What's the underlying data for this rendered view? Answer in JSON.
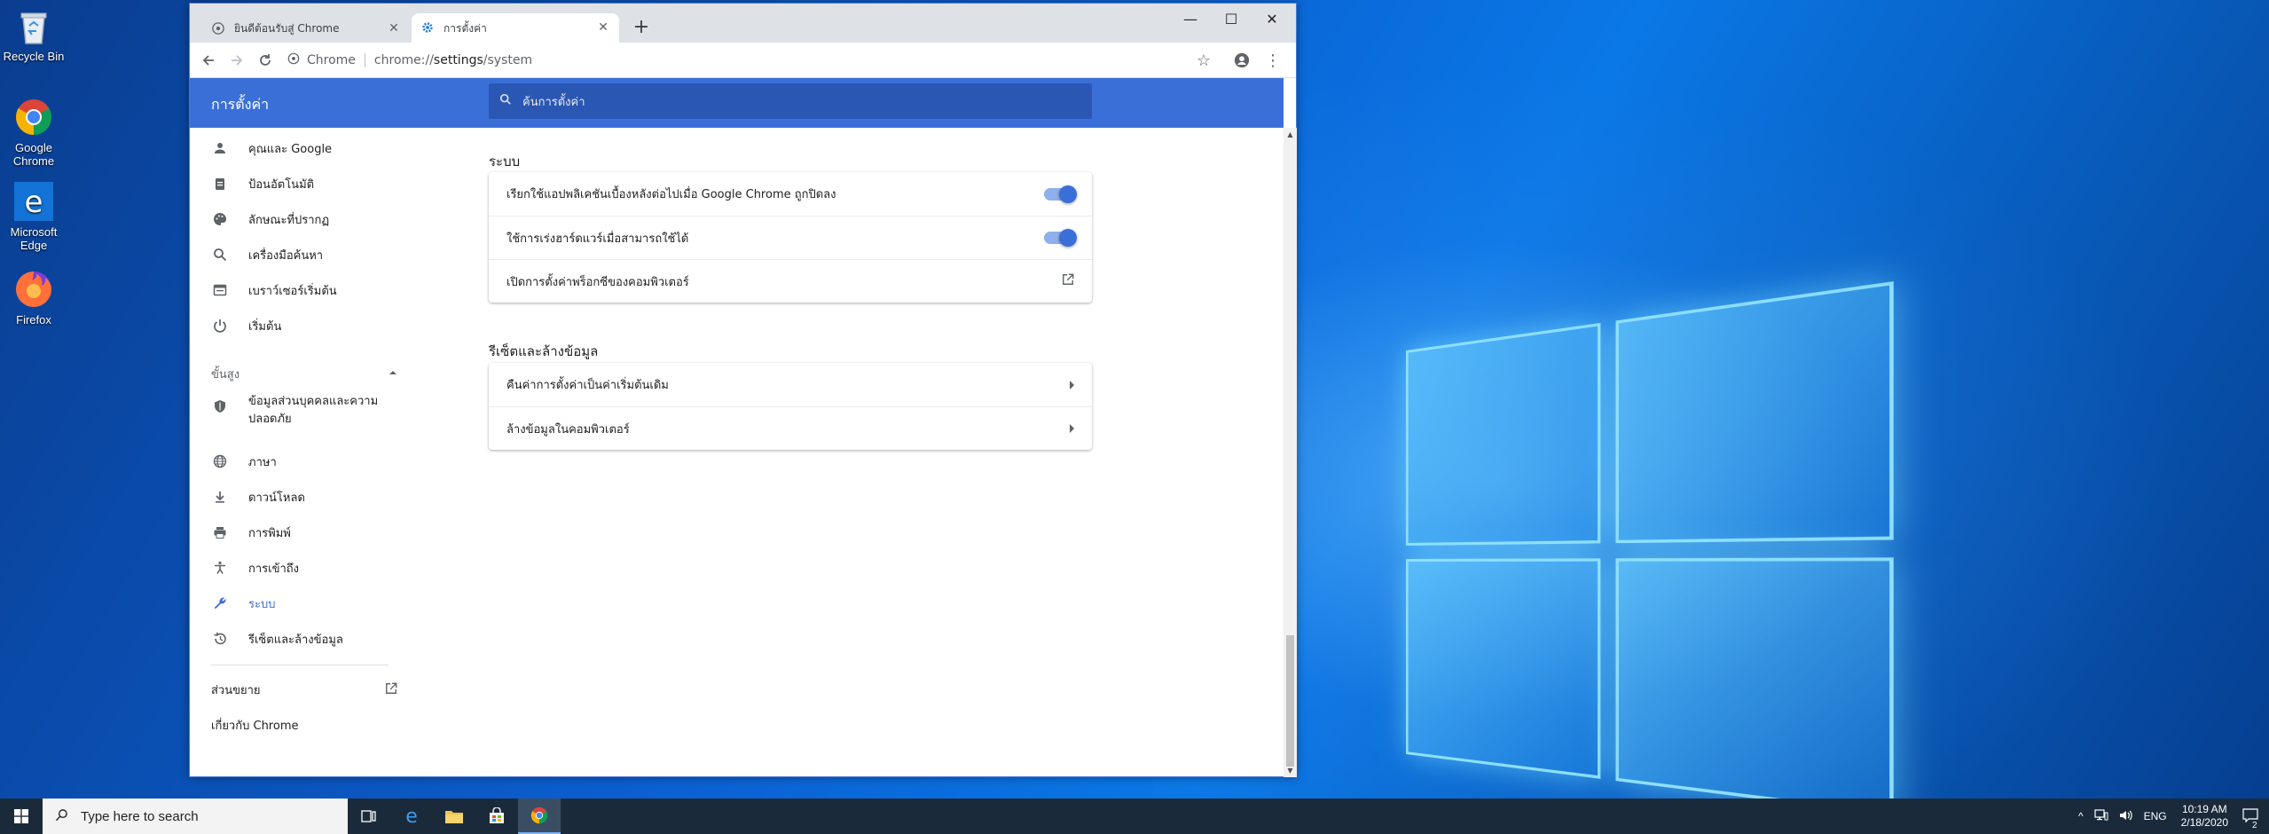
{
  "desktop": {
    "icons": [
      {
        "label": "Recycle Bin"
      },
      {
        "label": "Google Chrome"
      },
      {
        "label": "Microsoft Edge"
      },
      {
        "label": "Firefox"
      }
    ]
  },
  "browser": {
    "tabs": [
      {
        "title": "ยินดีต้อนรับสู่ Chrome"
      },
      {
        "title": "การตั้งค่า"
      }
    ],
    "address": {
      "chip": "Chrome",
      "url_scheme": "chrome://",
      "url_host": "settings",
      "url_path": "/system"
    }
  },
  "settings": {
    "title": "การตั้งค่า",
    "search_placeholder": "ค้นการตั้งค่า",
    "sidebar": {
      "items": [
        {
          "label": "คุณและ Google",
          "icon": "person-icon"
        },
        {
          "label": "ป้อนอัตโนมัติ",
          "icon": "clipboard-icon"
        },
        {
          "label": "ลักษณะที่ปรากฏ",
          "icon": "palette-icon"
        },
        {
          "label": "เครื่องมือค้นหา",
          "icon": "search-icon"
        },
        {
          "label": "เบราว์เซอร์เริ่มต้น",
          "icon": "browser-icon"
        },
        {
          "label": "เริ่มต้น",
          "icon": "power-icon"
        }
      ],
      "advanced_label": "ขั้นสูง",
      "advanced_items": [
        {
          "label": "ข้อมูลส่วนบุคคลและความปลอดภัย",
          "icon": "shield-icon"
        },
        {
          "label": "ภาษา",
          "icon": "globe-icon"
        },
        {
          "label": "ดาวน์โหลด",
          "icon": "download-icon"
        },
        {
          "label": "การพิมพ์",
          "icon": "printer-icon"
        },
        {
          "label": "การเข้าถึง",
          "icon": "accessibility-icon"
        },
        {
          "label": "ระบบ",
          "icon": "wrench-icon"
        },
        {
          "label": "รีเซ็ตและล้างข้อมูล",
          "icon": "restore-icon"
        }
      ],
      "extensions_label": "ส่วนขยาย",
      "about_label": "เกี่ยวกับ Chrome"
    },
    "system_section": {
      "title": "ระบบ",
      "rows": [
        {
          "label": "เรียกใช้แอปพลิเคชันเบื้องหลังต่อไปเมื่อ Google Chrome ถูกปิดลง",
          "toggle": true
        },
        {
          "label": "ใช้การเร่งฮาร์ดแวร์เมื่อสามารถใช้ได้",
          "toggle": true
        },
        {
          "label": "เปิดการตั้งค่าพร็อกซีของคอมพิวเตอร์"
        }
      ]
    },
    "reset_section": {
      "title": "รีเซ็ตและล้างข้อมูล",
      "rows": [
        {
          "label": "คืนค่าการตั้งค่าเป็นค่าเริ่มต้นเดิม"
        },
        {
          "label": "ล้างข้อมูลในคอมพิวเตอร์"
        }
      ]
    }
  },
  "taskbar": {
    "search_placeholder": "Type here to search",
    "language": "ENG",
    "time": "10:19 AM",
    "date": "2/18/2020",
    "notification_count": "2"
  },
  "colors": {
    "accent": "#3b6fd8",
    "header": "#3b6fd8",
    "taskbar": "#1b2a3b"
  }
}
